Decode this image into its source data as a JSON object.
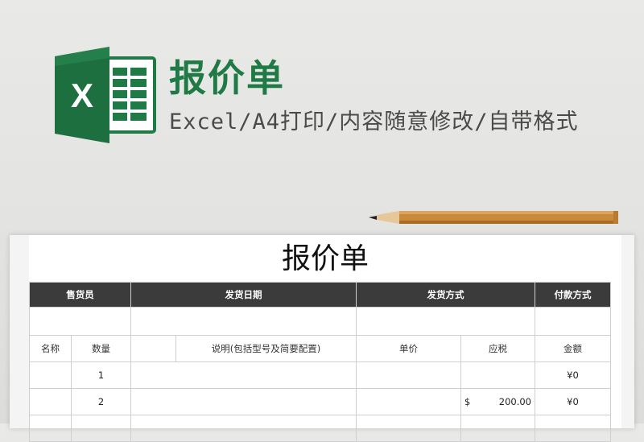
{
  "header": {
    "title": "报价单",
    "subtitle": "Excel/A4打印/内容随意修改/自带格式",
    "logo_letter": "X",
    "brand_color": "#1f7a45"
  },
  "document": {
    "title": "报价单",
    "info_headers": [
      "售货员",
      "发货日期",
      "发货方式",
      "付款方式"
    ],
    "columns": [
      "名称",
      "数量",
      "说明(包括型号及简要配置)",
      "单价",
      "应税",
      "金额"
    ],
    "rows": [
      {
        "name": "",
        "qty": "1",
        "desc": "",
        "unit_price": "",
        "tax_symbol": "",
        "tax": "",
        "amount": "¥0"
      },
      {
        "name": "",
        "qty": "2",
        "desc": "",
        "unit_price": "",
        "tax_symbol": "$",
        "tax": "200.00",
        "amount": "¥0"
      }
    ],
    "header_bg": "#3b3b3b"
  }
}
